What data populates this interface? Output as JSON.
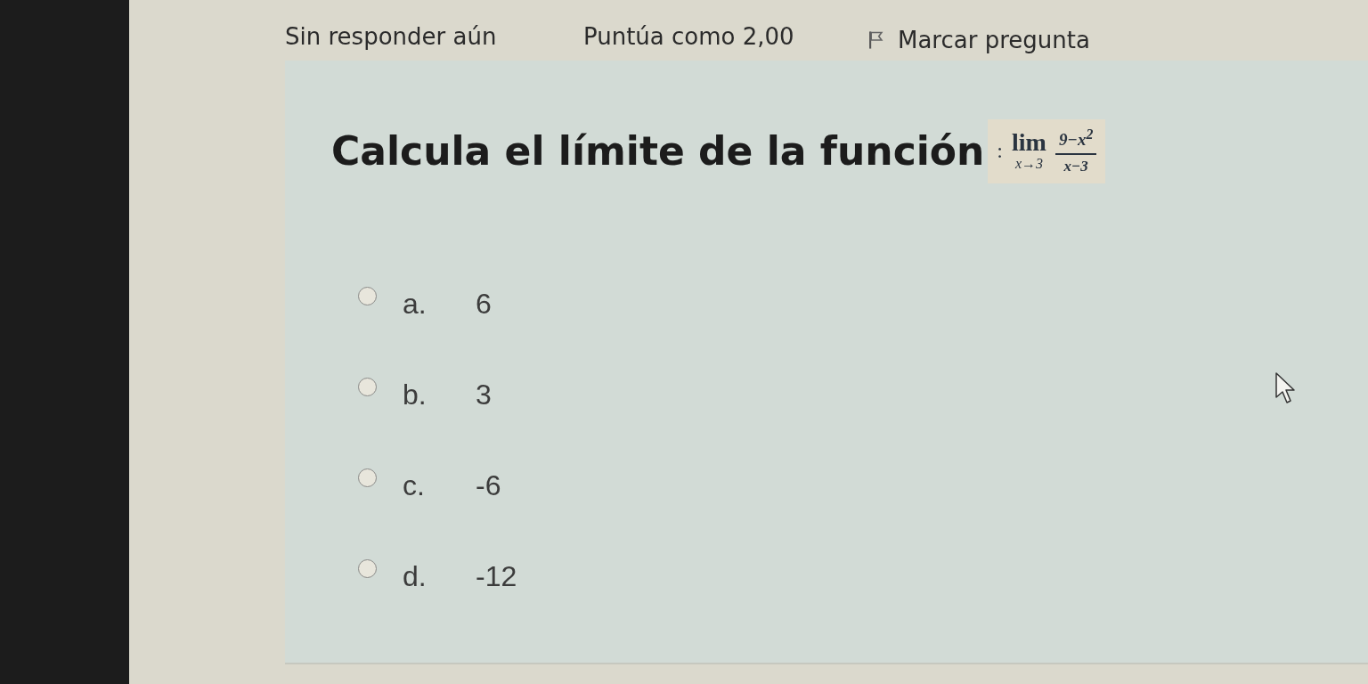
{
  "info": {
    "state": "Sin responder aún",
    "grade": "Puntúa como 2,00",
    "flag": {
      "label": "Marcar pregunta",
      "flagged": false
    }
  },
  "question": {
    "text": "Calcula el límite de la función",
    "separator": ":",
    "formula": {
      "operator": "lim",
      "subscript": "x→3",
      "numerator": "9−x$^{2}$",
      "denominator": "x−3"
    }
  },
  "answers": [
    {
      "letter": "a.",
      "text": "6",
      "selected": false
    },
    {
      "letter": "b.",
      "text": "3",
      "selected": false
    },
    {
      "letter": "c.",
      "text": "-6",
      "selected": false
    },
    {
      "letter": "d.",
      "text": "-12",
      "selected": false
    }
  ]
}
